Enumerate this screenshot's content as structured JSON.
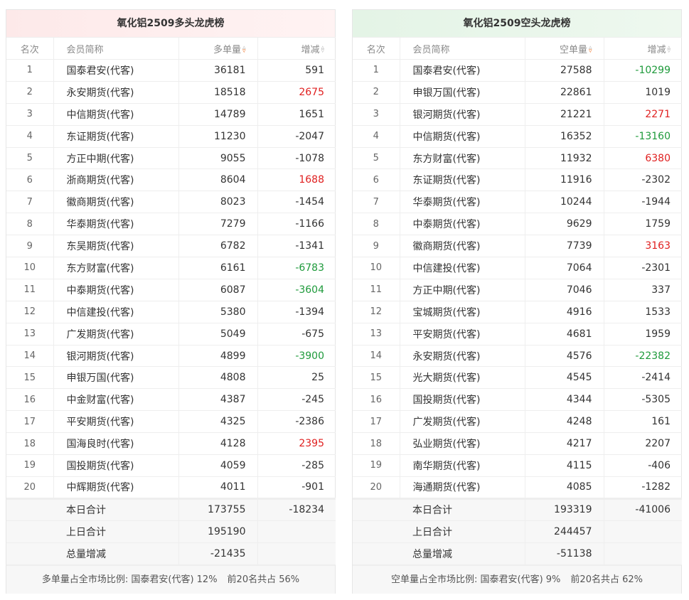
{
  "long": {
    "title": "氧化铝2509多头龙虎榜",
    "headers": {
      "rank": "名次",
      "member": "会员简称",
      "volume": "多单量",
      "change": "增减"
    },
    "rows": [
      {
        "rank": "1",
        "member": "国泰君安(代客)",
        "volume": "36181",
        "change": "591",
        "dir": ""
      },
      {
        "rank": "2",
        "member": "永安期货(代客)",
        "volume": "18518",
        "change": "2675",
        "dir": "up"
      },
      {
        "rank": "3",
        "member": "中信期货(代客)",
        "volume": "14789",
        "change": "1651",
        "dir": ""
      },
      {
        "rank": "4",
        "member": "东证期货(代客)",
        "volume": "11230",
        "change": "-2047",
        "dir": ""
      },
      {
        "rank": "5",
        "member": "方正中期(代客)",
        "volume": "9055",
        "change": "-1078",
        "dir": ""
      },
      {
        "rank": "6",
        "member": "浙商期货(代客)",
        "volume": "8604",
        "change": "1688",
        "dir": "up"
      },
      {
        "rank": "7",
        "member": "徽商期货(代客)",
        "volume": "8023",
        "change": "-1454",
        "dir": ""
      },
      {
        "rank": "8",
        "member": "华泰期货(代客)",
        "volume": "7279",
        "change": "-1166",
        "dir": ""
      },
      {
        "rank": "9",
        "member": "东吴期货(代客)",
        "volume": "6782",
        "change": "-1341",
        "dir": ""
      },
      {
        "rank": "10",
        "member": "东方财富(代客)",
        "volume": "6161",
        "change": "-6783",
        "dir": "down"
      },
      {
        "rank": "11",
        "member": "中泰期货(代客)",
        "volume": "6087",
        "change": "-3604",
        "dir": "down"
      },
      {
        "rank": "12",
        "member": "中信建投(代客)",
        "volume": "5380",
        "change": "-1394",
        "dir": ""
      },
      {
        "rank": "13",
        "member": "广发期货(代客)",
        "volume": "5049",
        "change": "-675",
        "dir": ""
      },
      {
        "rank": "14",
        "member": "银河期货(代客)",
        "volume": "4899",
        "change": "-3900",
        "dir": "down"
      },
      {
        "rank": "15",
        "member": "申银万国(代客)",
        "volume": "4808",
        "change": "25",
        "dir": ""
      },
      {
        "rank": "16",
        "member": "中金财富(代客)",
        "volume": "4387",
        "change": "-245",
        "dir": ""
      },
      {
        "rank": "17",
        "member": "平安期货(代客)",
        "volume": "4325",
        "change": "-2386",
        "dir": ""
      },
      {
        "rank": "18",
        "member": "国海良时(代客)",
        "volume": "4128",
        "change": "2395",
        "dir": "up"
      },
      {
        "rank": "19",
        "member": "国投期货(代客)",
        "volume": "4059",
        "change": "-285",
        "dir": ""
      },
      {
        "rank": "20",
        "member": "中辉期货(代客)",
        "volume": "4011",
        "change": "-901",
        "dir": ""
      }
    ],
    "summary": [
      {
        "label": "本日合计",
        "volume": "173755",
        "change": "-18234"
      },
      {
        "label": "上日合计",
        "volume": "195190",
        "change": ""
      },
      {
        "label": "总量增减",
        "volume": "-21435",
        "change": ""
      }
    ],
    "footer_share": "多单量占全市场比例: 国泰君安(代客) 12%",
    "footer_top20": "前20名共占 56%"
  },
  "short": {
    "title": "氧化铝2509空头龙虎榜",
    "headers": {
      "rank": "名次",
      "member": "会员简称",
      "volume": "空单量",
      "change": "增减"
    },
    "rows": [
      {
        "rank": "1",
        "member": "国泰君安(代客)",
        "volume": "27588",
        "change": "-10299",
        "dir": "down"
      },
      {
        "rank": "2",
        "member": "申银万国(代客)",
        "volume": "22861",
        "change": "1019",
        "dir": ""
      },
      {
        "rank": "3",
        "member": "银河期货(代客)",
        "volume": "21221",
        "change": "2271",
        "dir": "up"
      },
      {
        "rank": "4",
        "member": "中信期货(代客)",
        "volume": "16352",
        "change": "-13160",
        "dir": "down"
      },
      {
        "rank": "5",
        "member": "东方财富(代客)",
        "volume": "11932",
        "change": "6380",
        "dir": "up"
      },
      {
        "rank": "6",
        "member": "东证期货(代客)",
        "volume": "11916",
        "change": "-2302",
        "dir": ""
      },
      {
        "rank": "7",
        "member": "华泰期货(代客)",
        "volume": "10244",
        "change": "-1944",
        "dir": ""
      },
      {
        "rank": "8",
        "member": "中泰期货(代客)",
        "volume": "9629",
        "change": "1759",
        "dir": ""
      },
      {
        "rank": "9",
        "member": "徽商期货(代客)",
        "volume": "7739",
        "change": "3163",
        "dir": "up"
      },
      {
        "rank": "10",
        "member": "中信建投(代客)",
        "volume": "7064",
        "change": "-2301",
        "dir": ""
      },
      {
        "rank": "11",
        "member": "方正中期(代客)",
        "volume": "7046",
        "change": "337",
        "dir": ""
      },
      {
        "rank": "12",
        "member": "宝城期货(代客)",
        "volume": "4916",
        "change": "1533",
        "dir": ""
      },
      {
        "rank": "13",
        "member": "平安期货(代客)",
        "volume": "4681",
        "change": "1959",
        "dir": ""
      },
      {
        "rank": "14",
        "member": "永安期货(代客)",
        "volume": "4576",
        "change": "-22382",
        "dir": "down"
      },
      {
        "rank": "15",
        "member": "光大期货(代客)",
        "volume": "4545",
        "change": "-2414",
        "dir": ""
      },
      {
        "rank": "16",
        "member": "国投期货(代客)",
        "volume": "4344",
        "change": "-5305",
        "dir": ""
      },
      {
        "rank": "17",
        "member": "广发期货(代客)",
        "volume": "4248",
        "change": "161",
        "dir": ""
      },
      {
        "rank": "18",
        "member": "弘业期货(代客)",
        "volume": "4217",
        "change": "2207",
        "dir": ""
      },
      {
        "rank": "19",
        "member": "南华期货(代客)",
        "volume": "4115",
        "change": "-406",
        "dir": ""
      },
      {
        "rank": "20",
        "member": "海通期货(代客)",
        "volume": "4085",
        "change": "-1282",
        "dir": ""
      }
    ],
    "summary": [
      {
        "label": "本日合计",
        "volume": "193319",
        "change": "-41006"
      },
      {
        "label": "上日合计",
        "volume": "244457",
        "change": ""
      },
      {
        "label": "总量增减",
        "volume": "-51138",
        "change": ""
      }
    ],
    "footer_share": "空单量占全市场比例: 国泰君安(代客) 9%",
    "footer_top20": "前20名共占 62%"
  },
  "colors": {
    "up": "#e02020",
    "down": "#1e9a3b",
    "sort_active": "#f07020"
  },
  "icons": {
    "sort": "sort-updown-icon"
  }
}
